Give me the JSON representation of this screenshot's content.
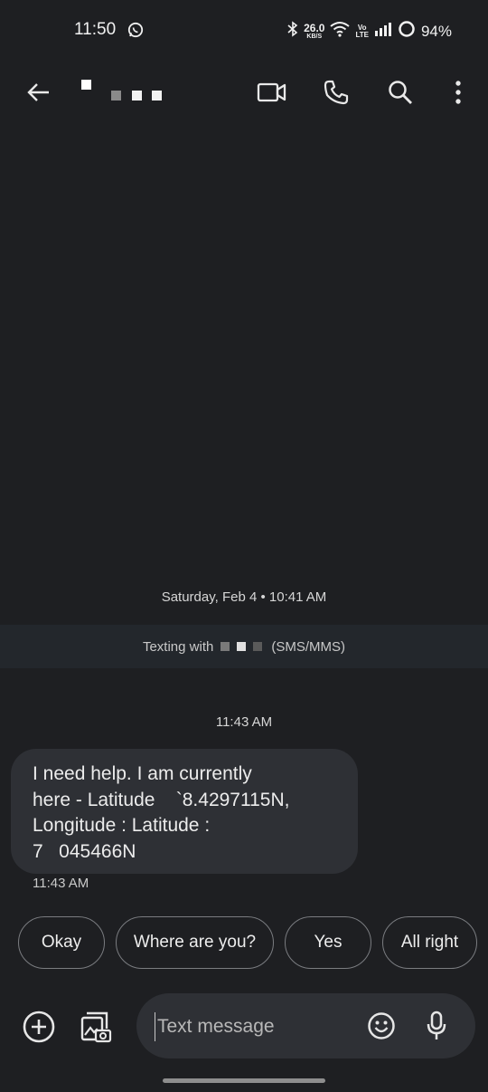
{
  "status_bar": {
    "time": "11:50",
    "speed_value": "26.0",
    "speed_unit": "KB/S",
    "volte_top": "Vo",
    "volte_bottom": "LTE",
    "battery": "94%"
  },
  "app_bar": {
    "back_icon": "arrow-left-icon",
    "video_icon": "video-camera-icon",
    "call_icon": "phone-icon",
    "search_icon": "search-icon",
    "more_icon": "more-vertical-icon"
  },
  "conversation": {
    "date_divider": "Saturday, Feb 4 • 10:41 AM",
    "texting_prefix": "Texting with",
    "texting_suffix": "(SMS/MMS)",
    "message_time_header": "11:43 AM",
    "message": {
      "lines": [
        "I need help. I am currently",
        "here - Latitude    `8.4297115N,",
        "Longitude : Latitude :",
        "7   045466N"
      ],
      "time": "11:43 AM"
    }
  },
  "smart_replies": [
    "Okay",
    "Where are you?",
    "Yes",
    "All right"
  ],
  "compose": {
    "placeholder": "Text message",
    "add_icon": "plus-circle-icon",
    "gallery_icon": "gallery-icon",
    "emoji_icon": "emoji-icon",
    "mic_icon": "microphone-icon"
  },
  "colors": {
    "background": "#1e1f22",
    "bubble": "#2e3035",
    "banner": "#23272c",
    "text": "#e3e3e3"
  }
}
